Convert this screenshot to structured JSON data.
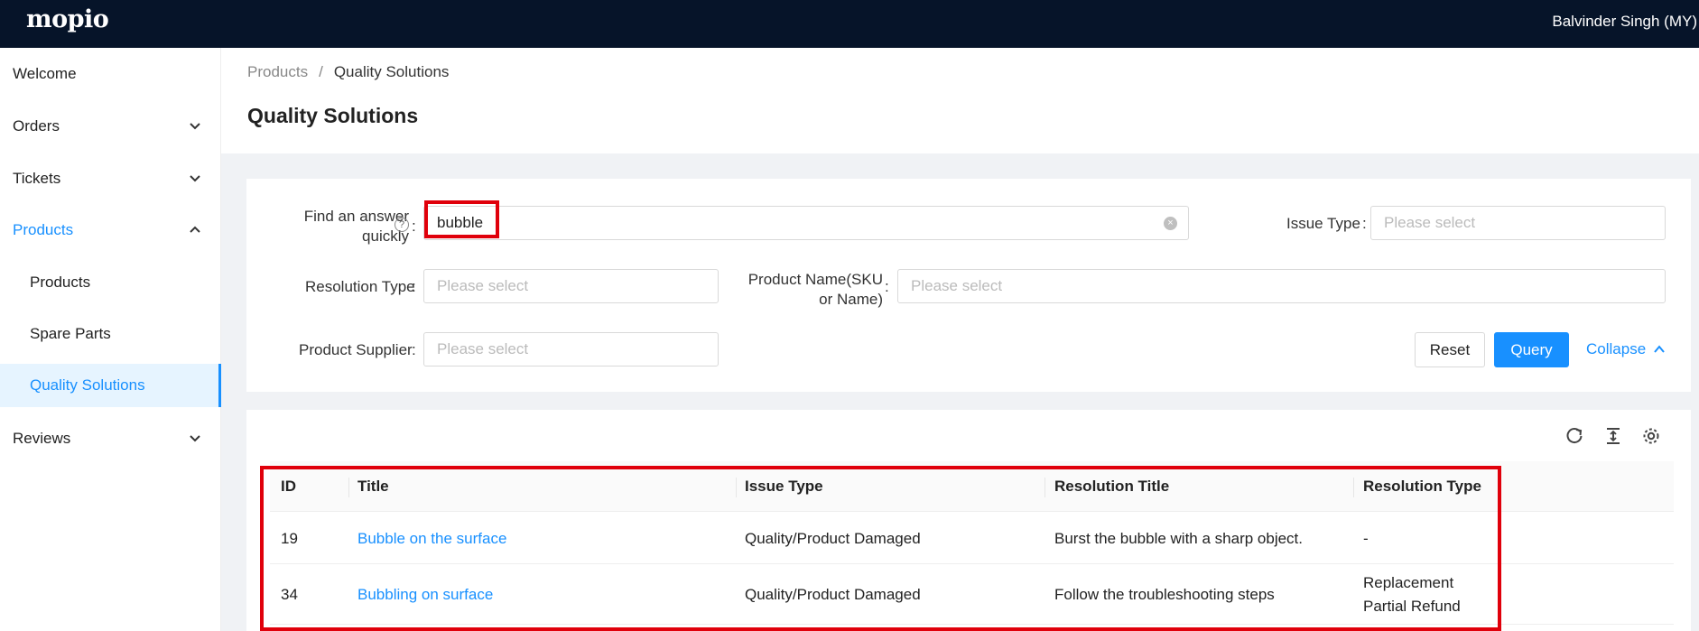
{
  "app": {
    "logo": "mopio",
    "user": "Balvinder Singh (MY)"
  },
  "sidebar": {
    "items": [
      {
        "label": "Welcome"
      },
      {
        "label": "Orders"
      },
      {
        "label": "Tickets"
      },
      {
        "label": "Products"
      },
      {
        "label": "Products"
      },
      {
        "label": "Spare Parts"
      },
      {
        "label": "Quality Solutions"
      },
      {
        "label": "Reviews"
      }
    ]
  },
  "breadcrumb": {
    "root": "Products",
    "sep": "/",
    "current": "Quality Solutions"
  },
  "page": {
    "title": "Quality Solutions"
  },
  "filters": {
    "find": {
      "label_line1": "Find an answer",
      "label_line2": "quickly",
      "help": "?",
      "value": "bubble"
    },
    "issue_type": {
      "label": "Issue Type",
      "placeholder": "Please select"
    },
    "resolution_type": {
      "label": "Resolution Type",
      "placeholder": "Please select"
    },
    "product_name": {
      "label_line1": "Product Name(SKU",
      "label_line2": "or Name)",
      "placeholder": "Please select"
    },
    "product_supplier": {
      "label": "Product Supplier",
      "placeholder": "Please select"
    },
    "colon": ":",
    "reset_label": "Reset",
    "query_label": "Query",
    "collapse_label": "Collapse"
  },
  "table": {
    "columns": [
      "ID",
      "Title",
      "Issue Type",
      "Resolution Title",
      "Resolution Type"
    ],
    "rows": [
      {
        "id": "19",
        "title": "Bubble on the surface",
        "issue_type": "Quality/Product Damaged",
        "resolution_title": "Burst the bubble with a sharp object.",
        "resolution_type_1": "-",
        "resolution_type_2": ""
      },
      {
        "id": "34",
        "title": "Bubbling on surface",
        "issue_type": "Quality/Product Damaged",
        "resolution_title": "Follow the troubleshooting steps",
        "resolution_type_1": "Replacement",
        "resolution_type_2": "Partial Refund"
      }
    ]
  },
  "colors": {
    "accent": "#1890ff",
    "topbar": "#061429",
    "highlight": "#e0000b"
  }
}
